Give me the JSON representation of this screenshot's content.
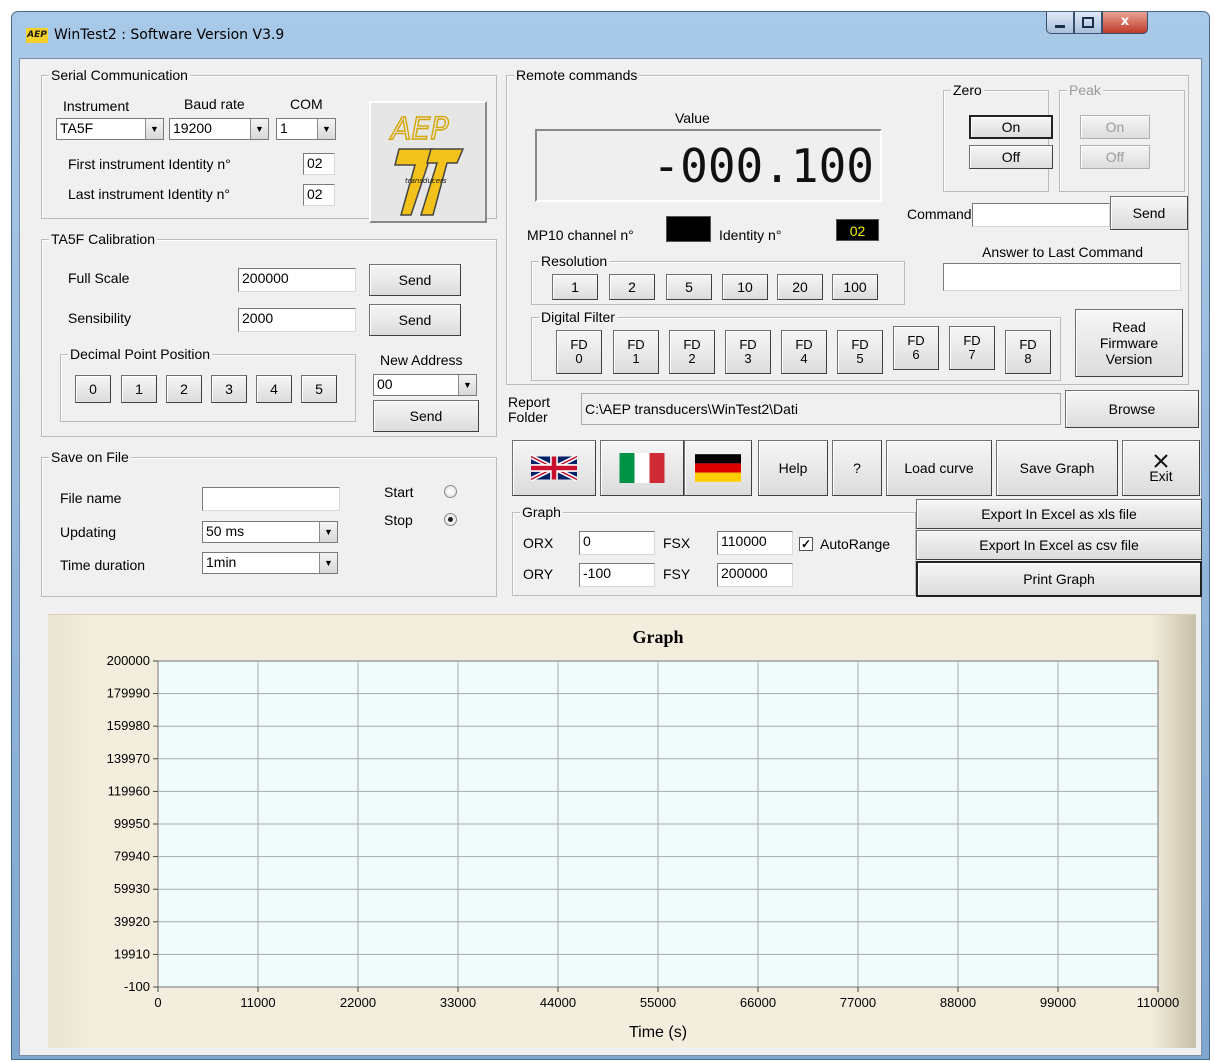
{
  "window": {
    "title": "WinTest2 : Software Version V3.9",
    "icon_text": "AEP",
    "minimize_icon": "minimize-icon",
    "maximize_icon": "maximize-icon",
    "close_icon": "close-icon",
    "close_label": "x"
  },
  "serial": {
    "title": "Serial Communication",
    "instrument_label": "Instrument",
    "baud_label": "Baud rate",
    "com_label": "COM",
    "instrument_value": "TA5F",
    "baud_value": "19200",
    "com_value": "1",
    "first_id_label": "First instrument Identity n°",
    "first_id_value": "02",
    "last_id_label": "Last instrument Identity n°",
    "last_id_value": "02"
  },
  "logo": {
    "text": "AEP",
    "subtext": "transducers"
  },
  "calibration": {
    "title": "TA5F Calibration",
    "full_scale_label": "Full Scale",
    "full_scale_value": "200000",
    "sensibility_label": "Sensibility",
    "sensibility_value": "2000",
    "send_label": "Send",
    "decimal_title": "Decimal Point Position",
    "decimal_buttons": [
      "0",
      "1",
      "2",
      "3",
      "4",
      "5"
    ],
    "new_address_label": "New Address",
    "new_address_value": "00"
  },
  "save_file": {
    "title": "Save on File",
    "file_name_label": "File name",
    "file_name_value": "",
    "updating_label": "Updating",
    "updating_value": "50 ms",
    "time_duration_label": "Time duration",
    "time_duration_value": "1min",
    "start_label": "Start",
    "stop_label": "Stop",
    "selected": "Stop"
  },
  "remote": {
    "title": "Remote commands",
    "value_label": "Value",
    "value_display": "-000.100",
    "zero_title": "Zero",
    "peak_title": "Peak",
    "on_label": "On",
    "off_label": "Off",
    "command_label": "Command",
    "command_value": "",
    "send_label": "Send",
    "answer_label": "Answer to Last Command",
    "answer_value": "",
    "mp10_label": "MP10 channel n°",
    "identity_label": "Identity n°",
    "identity_value": "02",
    "resolution_title": "Resolution",
    "resolution_buttons": [
      "1",
      "2",
      "5",
      "10",
      "20",
      "100"
    ],
    "filter_title": "Digital Filter",
    "filter_buttons": [
      "FD\n0",
      "FD\n1",
      "FD\n2",
      "FD\n3",
      "FD\n4",
      "FD\n5",
      "FD\n6",
      "FD\n7",
      "FD\n8"
    ],
    "read_firmware_label": "Read\nFirmware\nVersion"
  },
  "report": {
    "label": "Report\nFolder",
    "path": "C:\\AEP transducers\\WinTest2\\Dati",
    "browse_label": "Browse"
  },
  "toolbar": {
    "help_label": "Help",
    "question_label": "?",
    "load_curve_label": "Load curve",
    "save_graph_label": "Save Graph",
    "exit_label": "Exit",
    "exit_icon": "x-mark-icon",
    "uk_flag_icon": "uk-flag-icon",
    "italy_flag_icon": "italy-flag-icon",
    "germany_flag_icon": "germany-flag-icon"
  },
  "graph_settings": {
    "title": "Graph",
    "orx_label": "ORX",
    "orx_value": "0",
    "fsx_label": "FSX",
    "fsx_value": "110000",
    "ory_label": "ORY",
    "ory_value": "-100",
    "fsy_label": "FSY",
    "fsy_value": "200000",
    "autorange_label": "AutoRange",
    "autorange_checked": true
  },
  "export": {
    "xls_label": "Export In Excel as xls file",
    "csv_label": "Export In Excel as csv file",
    "print_label": "Print Graph"
  },
  "chart_data": {
    "type": "line",
    "title": "Graph",
    "xlabel": "Time (s)",
    "ylabel": "",
    "xlim": [
      0,
      110000
    ],
    "ylim": [
      -100,
      200000
    ],
    "x_ticks": [
      "0",
      "11000",
      "22000",
      "33000",
      "44000",
      "55000",
      "66000",
      "77000",
      "88000",
      "99000",
      "110000"
    ],
    "y_ticks": [
      "-100",
      "19910",
      "39920",
      "59930",
      "79940",
      "99950",
      "119960",
      "139970",
      "159980",
      "179990",
      "200000"
    ],
    "series": [],
    "grid": true,
    "plot_background": "#f0fcfc",
    "grid_color": "#a9a9a9"
  }
}
